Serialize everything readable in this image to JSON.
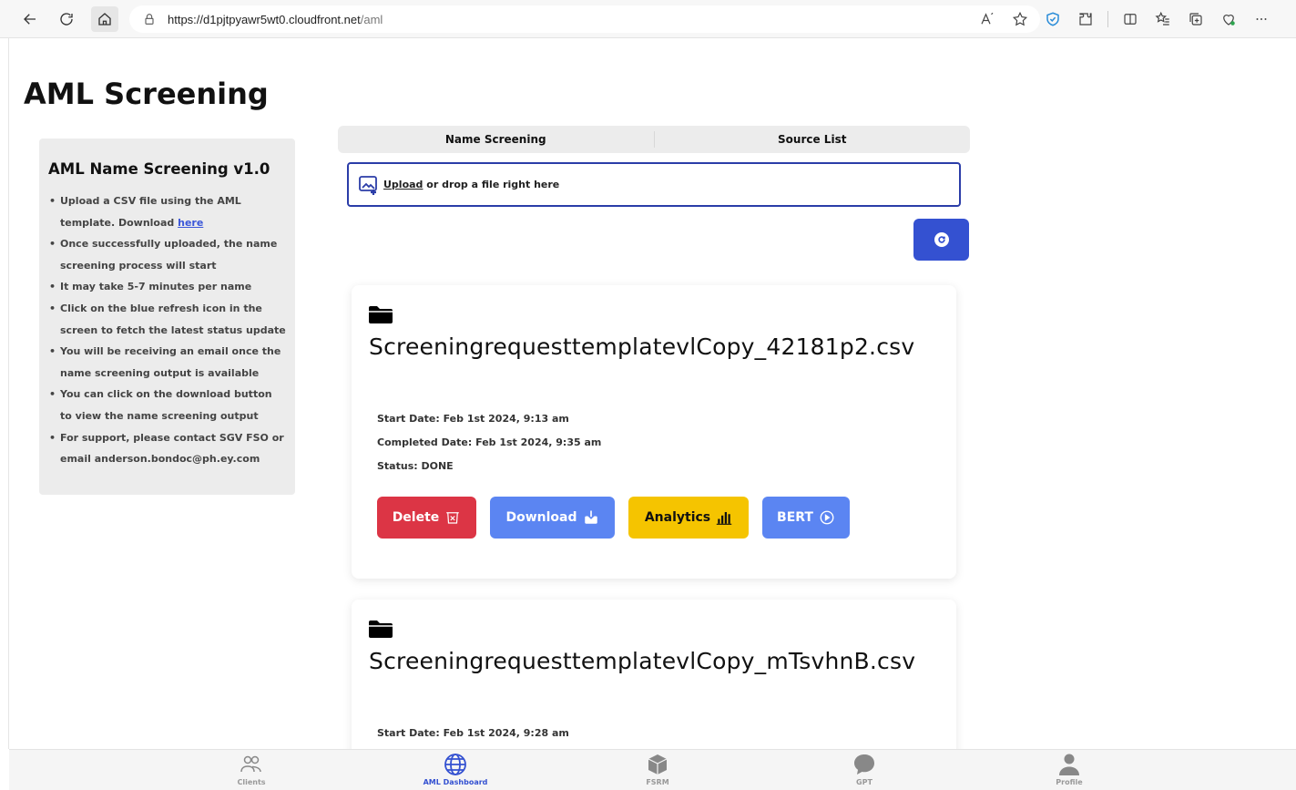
{
  "browser": {
    "url_host": "https://d1pjtpyawr5wt0.cloudfront.net",
    "url_path": "/aml"
  },
  "page": {
    "title": "AML Screening"
  },
  "instructions": {
    "title": "AML Name Screening v1.0",
    "items": [
      "Upload a CSV file using the AML template. Download",
      "Once successfully uploaded, the name screening process will start",
      "It may take 5-7 minutes per name",
      "Click on the blue refresh icon in the screen to fetch the latest status update",
      "You will be receiving an email once the name screening output is available",
      "You can click on the download button to view the name screening output",
      "For support, please contact SGV FSO or email anderson.bondoc@ph.ey.com"
    ],
    "link_label": "here"
  },
  "tabs": [
    {
      "label": "Name Screening"
    },
    {
      "label": "Source List"
    }
  ],
  "upload": {
    "link_label": "Upload",
    "text": " or drop a file right here"
  },
  "cards": [
    {
      "file_name": "ScreeningrequesttemplatevlCopy_42181p2.csv",
      "start": "Start Date: Feb 1st 2024, 9:13 am",
      "completed": "Completed Date: Feb 1st 2024, 9:35 am",
      "status": "Status: DONE",
      "actions": {
        "delete": "Delete",
        "download": "Download",
        "analytics": "Analytics",
        "bert": "BERT"
      }
    },
    {
      "file_name": "ScreeningrequesttemplatevlCopy_mTsvhnB.csv",
      "start": "Start Date: Feb 1st 2024, 9:28 am"
    }
  ],
  "bottom_nav": [
    {
      "label": "Clients",
      "icon": "users-icon"
    },
    {
      "label": "AML Dashboard",
      "icon": "globe-icon",
      "active": true
    },
    {
      "label": "FSRM",
      "icon": "cube-icon"
    },
    {
      "label": "GPT",
      "icon": "chat-bubble-icon"
    },
    {
      "label": "Profile",
      "icon": "person-icon"
    }
  ],
  "colors": {
    "primary": "#3451d1",
    "delete": "#dc3545",
    "download": "#5b85f2",
    "analytics": "#f5c400",
    "panel_bg": "#ececec"
  }
}
